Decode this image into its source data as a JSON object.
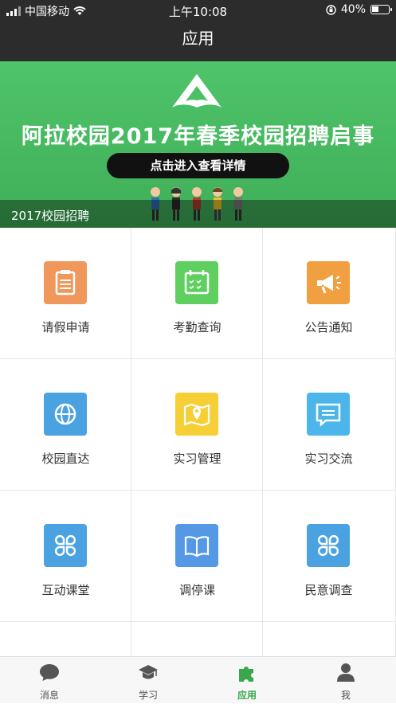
{
  "status": {
    "carrier": "中国移动",
    "time": "上午10:08",
    "battery": "40%",
    "battery_level": 0.4
  },
  "header": {
    "title": "应用"
  },
  "banner": {
    "title": "阿拉校园2017年春季校园招聘启事",
    "button": "点击进入查看详情",
    "caption": "2017校园招聘"
  },
  "apps": [
    {
      "label": "请假申请",
      "icon": "clipboard-icon",
      "color": "#f0975b"
    },
    {
      "label": "考勤查询",
      "icon": "calendar-icon",
      "color": "#5fcf60"
    },
    {
      "label": "公告通知",
      "icon": "megaphone-icon",
      "color": "#f0a040"
    },
    {
      "label": "校园直达",
      "icon": "globe-icon",
      "color": "#4aa3e0"
    },
    {
      "label": "实习管理",
      "icon": "map-pin-icon",
      "color": "#f5cf35"
    },
    {
      "label": "实习交流",
      "icon": "chat-icon",
      "color": "#4cb6ea"
    },
    {
      "label": "互动课堂",
      "icon": "clover-icon",
      "color": "#4aa3e0"
    },
    {
      "label": "调停课",
      "icon": "book-icon",
      "color": "#5598e6"
    },
    {
      "label": "民意调查",
      "icon": "clover-icon",
      "color": "#4aa3e0"
    }
  ],
  "tabs": [
    {
      "label": "消息",
      "icon": "chat-bubble-icon"
    },
    {
      "label": "学习",
      "icon": "graduation-cap-icon"
    },
    {
      "label": "应用",
      "icon": "puzzle-icon",
      "active": true
    },
    {
      "label": "我",
      "icon": "person-icon"
    }
  ],
  "colors": {
    "accent": "#3aa84a",
    "topbar": "#2c2c2c",
    "banner": "#4fc46a"
  }
}
